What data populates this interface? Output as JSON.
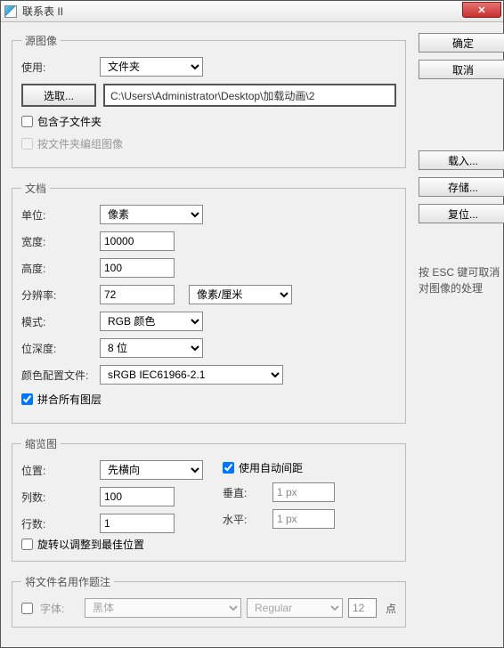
{
  "title": "联系表 II",
  "buttons": {
    "close": "✕",
    "ok": "确定",
    "cancel": "取消",
    "load": "载入...",
    "save": "存储...",
    "reset": "复位...",
    "choose": "选取..."
  },
  "hint_line1": "按 ESC 键可取消",
  "hint_line2": "对图像的处理",
  "source": {
    "legend": "源图像",
    "use_label": "使用:",
    "use_value": "文件夹",
    "path": "C:\\Users\\Administrator\\Desktop\\加载动画\\2",
    "include_sub_label": "包含子文件夹",
    "include_sub_checked": false,
    "group_by_folder_label": "按文件夹编组图像",
    "group_by_folder_checked": false
  },
  "doc": {
    "legend": "文档",
    "unit_label": "单位:",
    "unit_value": "像素",
    "width_label": "宽度:",
    "width_value": "10000",
    "height_label": "高度:",
    "height_value": "100",
    "res_label": "分辨率:",
    "res_value": "72",
    "res_unit": "像素/厘米",
    "mode_label": "模式:",
    "mode_value": "RGB 颜色",
    "depth_label": "位深度:",
    "depth_value": "8 位",
    "profile_label": "颜色配置文件:",
    "profile_value": "sRGB IEC61966-2.1",
    "flatten_label": "拼合所有图层",
    "flatten_checked": true
  },
  "thumb": {
    "legend": "缩览图",
    "place_label": "位置:",
    "place_value": "先横向",
    "autospace_label": "使用自动间距",
    "autospace_checked": true,
    "cols_label": "列数:",
    "cols_value": "100",
    "rows_label": "行数:",
    "rows_value": "1",
    "vert_label": "垂直:",
    "vert_value": "1 px",
    "horz_label": "水平:",
    "horz_value": "1 px",
    "rotate_label": "旋转以调整到最佳位置",
    "rotate_checked": false
  },
  "caption": {
    "legend": "将文件名用作题注",
    "font_label": "字体:",
    "font_face": "黑体",
    "font_style": "Regular",
    "font_size": "12",
    "pt": "点",
    "enabled": false
  }
}
